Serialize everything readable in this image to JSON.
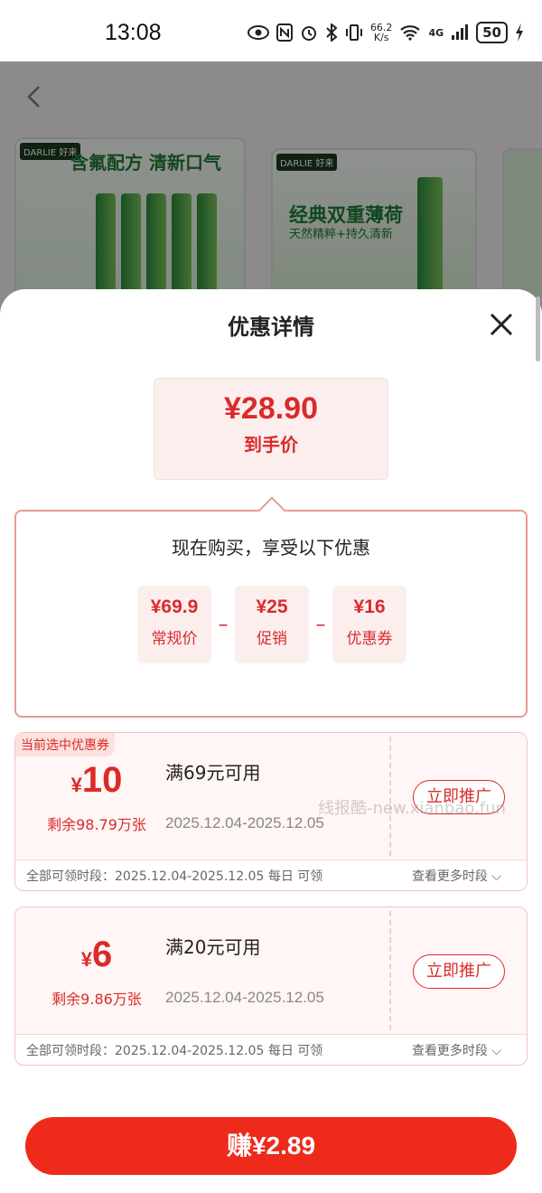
{
  "status_bar": {
    "time": "13:08",
    "speed_value": "66.2",
    "speed_unit": "K/s",
    "network": "4G",
    "battery": "50"
  },
  "background": {
    "card1_brand": "DARLIE 好来",
    "card1_slogan": "含氟配方 清新口气",
    "card2_brand": "DARLIE 好来",
    "card2_title": "经典双重薄荷",
    "card2_subtitle": "天然精粹+持久清新"
  },
  "sheet": {
    "title": "优惠详情",
    "final_price": "¥28.90",
    "final_price_label": "到手价",
    "breakdown_title": "现在购买，享受以下优惠",
    "breakdown": [
      {
        "amount": "¥69.9",
        "label": "常规价"
      },
      {
        "amount": "¥25",
        "label": "促销"
      },
      {
        "amount": "¥16",
        "label": "优惠券"
      }
    ],
    "minus_symbol": "–",
    "coupons": [
      {
        "tag": "当前选中优惠券",
        "currency": "¥",
        "amount": "10",
        "remaining": "剩余98.79万张",
        "condition": "满69元可用",
        "date_range": "2025.12.04-2025.12.05",
        "button": "立即推广",
        "period": "全部可领时段：2025.12.04-2025.12.05 每日 可领",
        "more": "查看更多时段 ⌵"
      },
      {
        "currency": "¥",
        "amount": "6",
        "remaining": "剩余9.86万张",
        "condition": "满20元可用",
        "date_range": "2025.12.04-2025.12.05",
        "button": "立即推广",
        "period": "全部可领时段：2025.12.04-2025.12.05 每日 可领",
        "more": "查看更多时段 ⌵"
      }
    ],
    "watermark": "线报酷-new.xianbao.fun",
    "earn_button": "赚¥2.89"
  },
  "colors": {
    "accent": "#d92b2b",
    "button": "#ee2a1b",
    "light_pink": "#fdeeee"
  }
}
